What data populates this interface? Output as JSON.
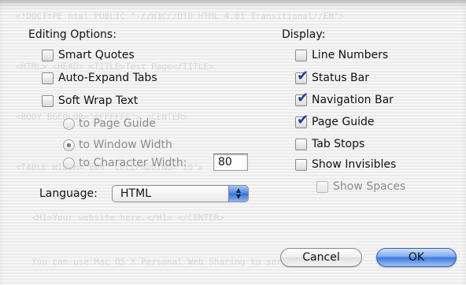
{
  "editing": {
    "heading": "Editing Options:",
    "smart_quotes": {
      "label": "Smart Quotes",
      "checked": false
    },
    "auto_expand_tabs": {
      "label": "Auto-Expand Tabs",
      "checked": false
    },
    "soft_wrap_text": {
      "label": "Soft Wrap Text",
      "checked": false
    },
    "wrap_options": [
      {
        "label": "to Page Guide",
        "selected": false,
        "enabled": false
      },
      {
        "label": "to Window Width",
        "selected": true,
        "enabled": false
      },
      {
        "label": "to Character Width:",
        "selected": false,
        "enabled": false
      }
    ],
    "character_width_value": "80",
    "language_label": "Language:",
    "language_value": "HTML"
  },
  "display": {
    "heading": "Display:",
    "line_numbers": {
      "label": "Line Numbers",
      "checked": false
    },
    "status_bar": {
      "label": "Status Bar",
      "checked": true
    },
    "navigation_bar": {
      "label": "Navigation Bar",
      "checked": true
    },
    "page_guide": {
      "label": "Page Guide",
      "checked": true
    },
    "tab_stops": {
      "label": "Tab Stops",
      "checked": false
    },
    "show_invisibles": {
      "label": "Show Invisibles",
      "checked": false
    },
    "show_spaces": {
      "label": "Show Spaces",
      "checked": false,
      "enabled": false
    }
  },
  "buttons": {
    "cancel": "Cancel",
    "ok": "OK"
  },
  "colors": {
    "check": "#1b3f9e",
    "default_button": "#3d79de",
    "sheet_bg": "#ececec"
  }
}
